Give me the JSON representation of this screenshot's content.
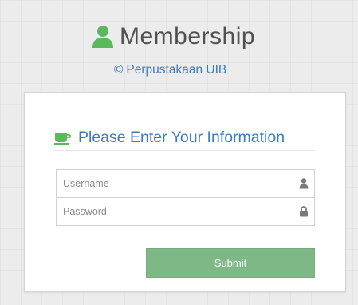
{
  "header": {
    "title": "Membership",
    "subtitle_symbol": "©",
    "subtitle": "Perpustakaan UIB",
    "icon": "user-icon"
  },
  "login_panel": {
    "heading": "Please Enter Your Information",
    "heading_icon": "coffee-cup-icon",
    "username": {
      "placeholder": "Username",
      "value": "",
      "icon": "user-icon"
    },
    "password": {
      "placeholder": "Password",
      "value": "",
      "icon": "lock-icon"
    },
    "submit_label": "Submit"
  },
  "colors": {
    "accent_green": "#5cb85c",
    "button_green": "#7fb887",
    "link_blue": "#3b7bbf",
    "title_gray": "#505050"
  }
}
